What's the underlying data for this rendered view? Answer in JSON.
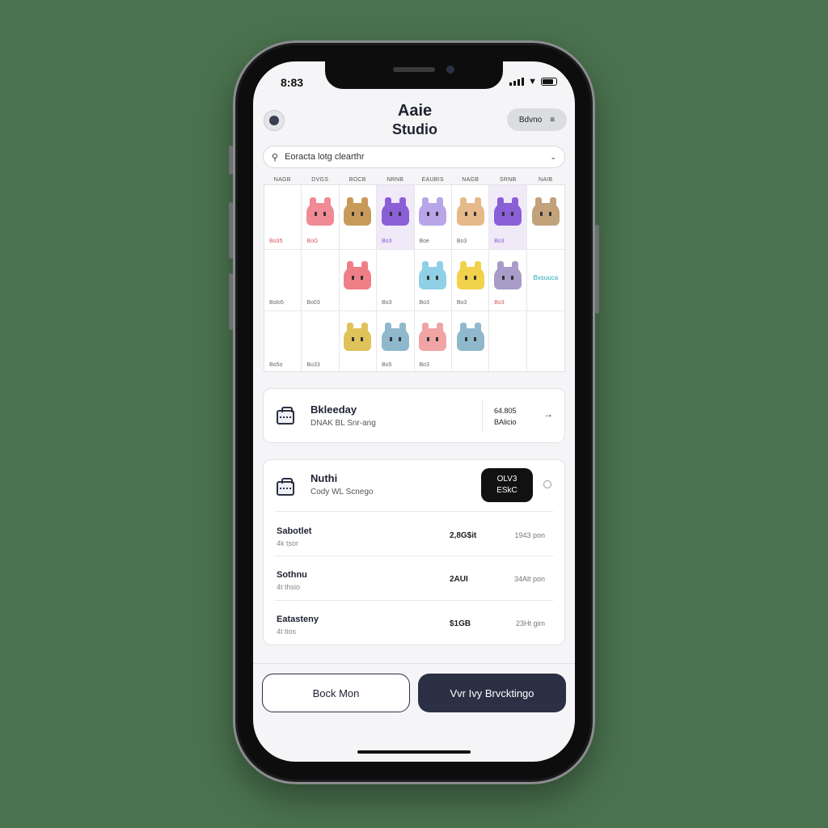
{
  "status": {
    "time": "8:83"
  },
  "header": {
    "title_line1": "Aaie",
    "title_line2": "Studio",
    "pill_label": "Bdvno",
    "pill_icon": "menu-icon"
  },
  "search": {
    "placeholder": "Eoracta lotg clearthr"
  },
  "grid": {
    "columns": [
      "NAGB",
      "DVGS",
      "BOCB",
      "NRNB",
      "EAUBIS",
      "NAGB",
      "SRNB",
      "NAIB"
    ],
    "rows": [
      [
        {
          "label": "Bo35",
          "color": "",
          "tone": "red"
        },
        {
          "label": "BoG",
          "color": "#f08a94",
          "tone": "red"
        },
        {
          "label": "",
          "color": "#c89a5a"
        },
        {
          "label": "Bo3",
          "color": "#8a5fd6",
          "tone": "purple",
          "highlight": true
        },
        {
          "label": "Boe",
          "color": "#b9a6e8"
        },
        {
          "label": "Bo3",
          "color": "#e6b98a"
        },
        {
          "label": "Bo3",
          "color": "#8a5fd6",
          "tone": "purple",
          "highlight": true
        },
        {
          "label": "",
          "color": "#c2a27a"
        }
      ],
      [
        {
          "label": "Bolo5",
          "color": ""
        },
        {
          "label": "Bo03",
          "color": ""
        },
        {
          "label": "",
          "color": "#ef7f86"
        },
        {
          "label": "Bo3",
          "color": ""
        },
        {
          "label": "Bo3",
          "color": "#8fd0e6"
        },
        {
          "label": "Bo3",
          "color": "#f2d24a"
        },
        {
          "label": "Bo3",
          "color": "#a89cc8",
          "tone": "red"
        },
        {
          "label": "Bxsuuca",
          "color": "",
          "tone": "teal",
          "mid": true
        }
      ],
      [
        {
          "label": "Bo5o",
          "color": ""
        },
        {
          "label": "Bo33",
          "color": ""
        },
        {
          "label": "",
          "color": "#e0c25a"
        },
        {
          "label": "Bo5",
          "color": "#8fb8cc"
        },
        {
          "label": "Bo3",
          "color": "#f0a4a4"
        },
        {
          "label": "",
          "color": "#8fb8cc"
        },
        {
          "label": "",
          "color": ""
        },
        {
          "label": "",
          "color": ""
        }
      ]
    ]
  },
  "card1": {
    "title": "Bkleeday",
    "subtitle": "DNAK BL Snr-ang",
    "right_line1": "64.805",
    "right_line2": "BAlicio"
  },
  "card2": {
    "title": "Nuthi",
    "subtitle": "Cody WL Scnego",
    "badge_line1": "OLV3",
    "badge_line2": "ESkC",
    "rows": [
      {
        "title": "Sabotlet",
        "sub": "4k tsor",
        "value": "2,8G$it",
        "value2": "1943 pon"
      },
      {
        "title": "Sothnu",
        "sub": "4t thsio",
        "value": "2AUI",
        "value2": "34Alt pon"
      },
      {
        "title": "Eatasteny",
        "sub": "4t tios",
        "value": "$1GB",
        "value2": "23Ht gim"
      }
    ]
  },
  "footer": {
    "back_label": "Bock Mon",
    "view_label": "Vvr Ivy Brvcktingo"
  },
  "colors": {
    "accent": "#2b3045",
    "background": "#4a724e"
  }
}
